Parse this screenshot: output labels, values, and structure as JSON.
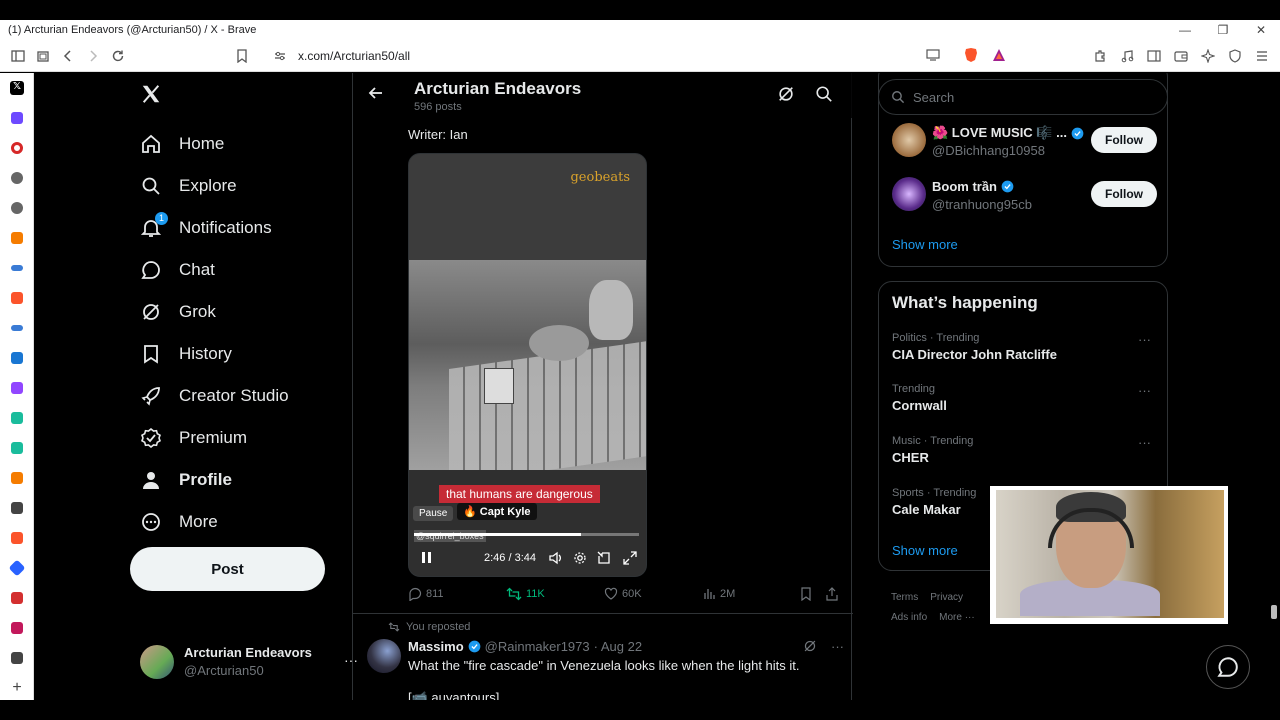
{
  "window": {
    "title": "(1) Arcturian Endeavors (@Arcturian50) / X - Brave"
  },
  "browser": {
    "url": "x.com/Arcturian50/all"
  },
  "nav": {
    "items": [
      {
        "label": "Home",
        "icon": "home-icon"
      },
      {
        "label": "Explore",
        "icon": "search-icon"
      },
      {
        "label": "Notifications",
        "icon": "bell-icon",
        "badge": "1"
      },
      {
        "label": "Chat",
        "icon": "chat-icon"
      },
      {
        "label": "Grok",
        "icon": "grok-icon"
      },
      {
        "label": "History",
        "icon": "bookmark-icon"
      },
      {
        "label": "Creator Studio",
        "icon": "rocket-icon"
      },
      {
        "label": "Premium",
        "icon": "verified-icon"
      },
      {
        "label": "Profile",
        "icon": "person-icon"
      },
      {
        "label": "More",
        "icon": "more-circle-icon"
      }
    ],
    "post_label": "Post",
    "account": {
      "name": "Arcturian Endeavors",
      "handle": "@Arcturian50"
    }
  },
  "profile_header": {
    "name": "Arcturian Endeavors",
    "posts": "596 posts"
  },
  "tweet1": {
    "writer": "Writer: Ian",
    "video": {
      "brand": "geobeats",
      "caption": "that humans are dangerous",
      "credit": "Capt Kyle",
      "watermark": "@squirrel_boxes",
      "tooltip": "Pause",
      "time": "2:46 / 3:44",
      "progress": 0.74
    },
    "replies": "811",
    "reposts": "11K",
    "likes": "60K",
    "views": "2M"
  },
  "tweet2": {
    "reposted_label": "You reposted",
    "name": "Massimo",
    "handle": "@Rainmaker1973",
    "date": "· Aug 22",
    "text": "What the \"fire cascade\" in Venezuela looks like when the light hits it.",
    "text2": "[📹 auyantours]"
  },
  "right": {
    "search_placeholder": "Search",
    "who_to_follow": [
      {
        "name": "🌺 LOVE MUSIC 🎼 ...",
        "handle": "@DBichhang10958",
        "follow": "Follow"
      },
      {
        "name": "Boom trần",
        "handle": "@tranhuong95cb",
        "follow": "Follow"
      }
    ],
    "show_more": "Show more",
    "happening_title": "What’s happening",
    "trends": [
      {
        "category": "Politics · Trending",
        "name": "CIA Director John Ratcliffe"
      },
      {
        "category": "Trending",
        "name": "Cornwall"
      },
      {
        "category": "Music · Trending",
        "name": "CHER"
      },
      {
        "category": "Sports · Trending",
        "name": "Cale Makar"
      }
    ],
    "show_more2": "Show more",
    "footer": [
      "Terms",
      "Privacy",
      "Ads info",
      "More ···"
    ]
  },
  "colors": {
    "accent": "#1d9bf0",
    "repost_green": "#00ba7c",
    "caption_red": "#c62b36"
  }
}
